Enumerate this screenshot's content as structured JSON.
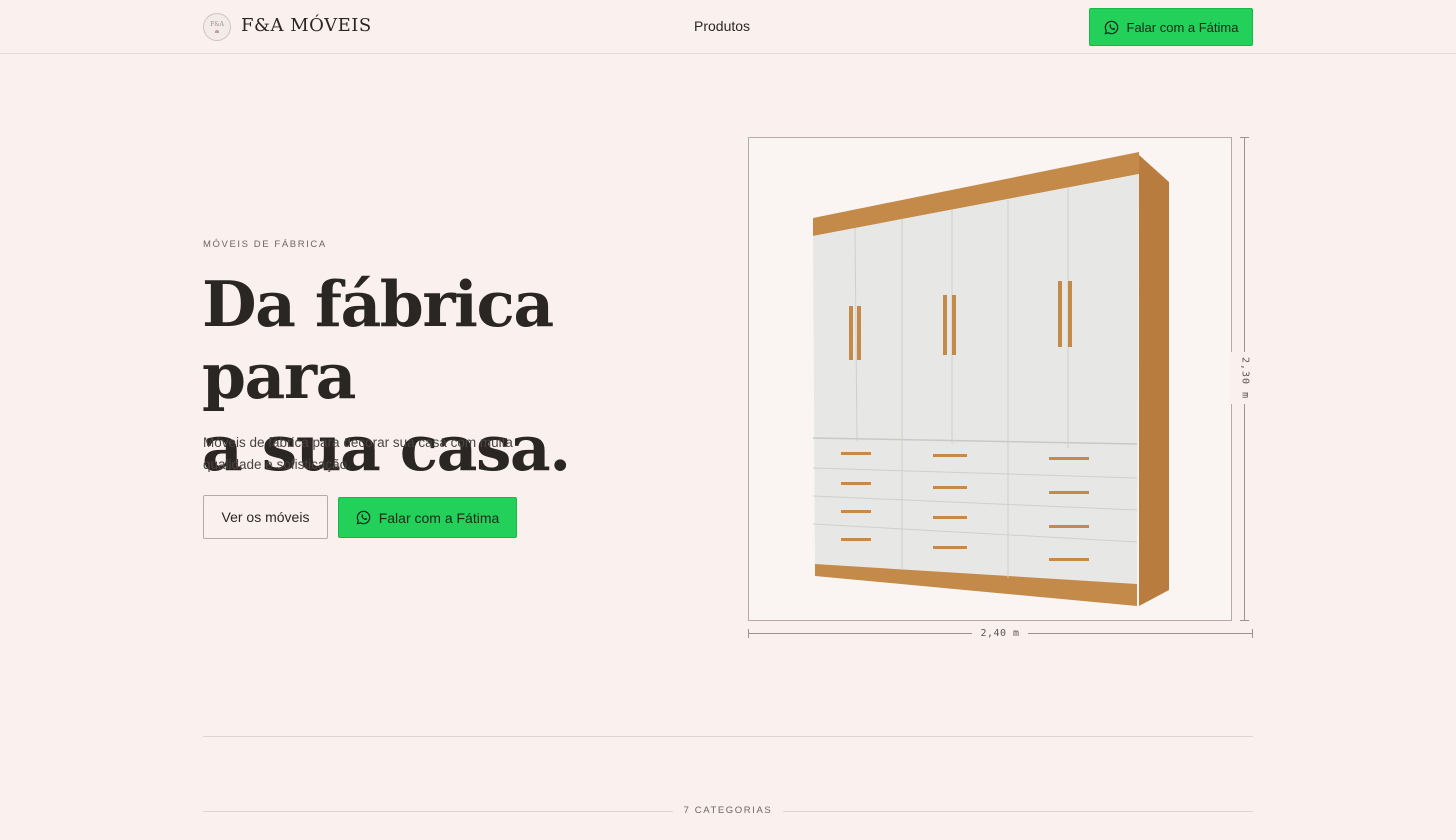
{
  "header": {
    "brand": "F&A MÓVEIS",
    "logo_text": "F&A",
    "nav_link": "Produtos",
    "cta_label": "Falar com a Fátima"
  },
  "hero": {
    "eyebrow": "MÓVEIS DE FÁBRICA",
    "headline_line1": "Da fábrica para",
    "headline_line2": "a sua casa.",
    "subtitle_line1": "Móveis de fábrica para decorar sua casa com muita",
    "subtitle_line2": "qualidade e sofisticação.",
    "primary_button": "Ver os móveis",
    "whatsapp_button": "Falar com a Fátima"
  },
  "product": {
    "height_label": "2,30 m",
    "width_label": "2,40 m"
  },
  "categories": {
    "label": "7 CATEGORIAS"
  },
  "colors": {
    "background": "#faf1ee",
    "whatsapp_green": "#22d05a",
    "text": "#2a2624",
    "wood": "#c48a4a"
  },
  "icons": {
    "whatsapp": "whatsapp-icon"
  }
}
